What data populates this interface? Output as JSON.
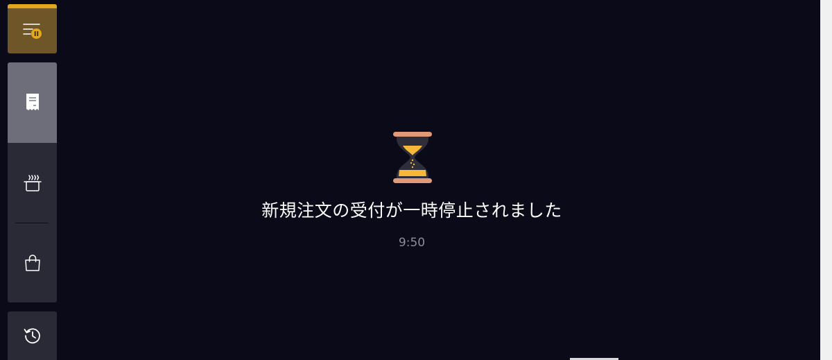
{
  "status": {
    "message": "新規注文の受付が一時停止されました",
    "time": "9:50"
  },
  "sidebar": {
    "items": [
      {
        "name": "pause-orders",
        "icon": "list-pause-icon",
        "active": true
      },
      {
        "name": "orders",
        "icon": "receipt-icon",
        "selected": true
      },
      {
        "name": "kitchen",
        "icon": "cooking-pot-icon"
      },
      {
        "name": "takeout",
        "icon": "shopping-bag-icon"
      },
      {
        "name": "history",
        "icon": "history-icon"
      }
    ]
  },
  "colors": {
    "background": "#0b0a19",
    "accent": "#e3a71d",
    "active_button": "#6e5628",
    "sidebar_group": "#2a2a36",
    "selected_item": "#6e6e7b",
    "time_text": "#8d8d99"
  },
  "hero_icon": "hourglass-icon"
}
